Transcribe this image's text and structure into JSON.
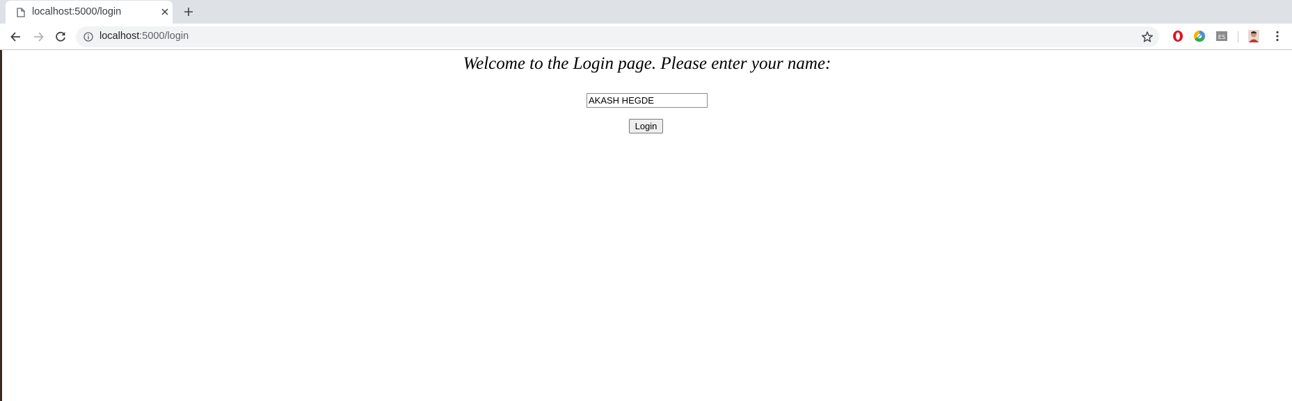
{
  "browser": {
    "tab": {
      "title": "localhost:5000/login"
    },
    "address_bar": {
      "host": "localhost",
      "path": ":5000/login"
    },
    "extensions": [
      {
        "name": "opera-icon",
        "color": "#e0121f"
      },
      {
        "name": "chrome-extension-icon",
        "color": "#4a90d9"
      },
      {
        "name": "es-extension-icon",
        "color": "#6b6b6b"
      },
      {
        "name": "profile-avatar-icon",
        "color": "#c0392b"
      }
    ]
  },
  "page": {
    "heading": "Welcome to the Login page. Please enter your name:",
    "name_input": {
      "value": "AKASH HEGDE"
    },
    "login_button": {
      "label": "Login"
    }
  },
  "colors": {
    "tabstrip": "#dee1e6",
    "omnibox": "#f1f3f4",
    "text": "#000000"
  }
}
